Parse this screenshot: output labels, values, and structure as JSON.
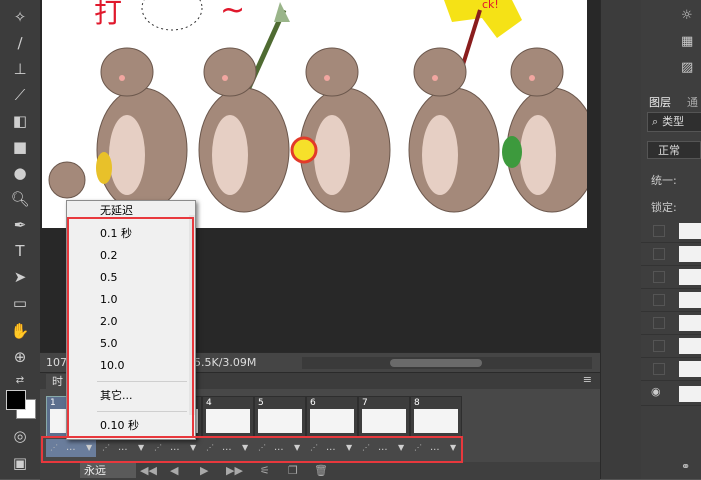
{
  "status_bar": {
    "zoom": "107.",
    "doc_size": "5.5K/3.09M"
  },
  "timeline": {
    "tab_label": "时",
    "frames": [
      {
        "number": "1",
        "selected": true
      },
      {
        "number": "2"
      },
      {
        "number": "3"
      },
      {
        "number": "4"
      },
      {
        "number": "5"
      },
      {
        "number": "6"
      },
      {
        "number": "7"
      },
      {
        "number": "8"
      }
    ],
    "delay_value": "...",
    "loop": "永远"
  },
  "delay_menu": {
    "items": [
      "无延迟",
      "0.1 秒",
      "0.2",
      "0.5",
      "1.0",
      "2.0",
      "5.0",
      "10.0"
    ],
    "other": "其它...",
    "current": "0.10 秒"
  },
  "layers_panel": {
    "tab": "图层",
    "tab2": "通",
    "kind_filter": "类型",
    "blend_mode": "正常",
    "unify_label": "统一:",
    "lock_label": "锁定:"
  },
  "canvas_text": {
    "top_char": "打",
    "squiggle": "~",
    "flag_text": "ck!"
  },
  "colors": {
    "highlight_red": "#e8383d",
    "bear_brown": "#a4897a",
    "app_bg": "#535353"
  }
}
